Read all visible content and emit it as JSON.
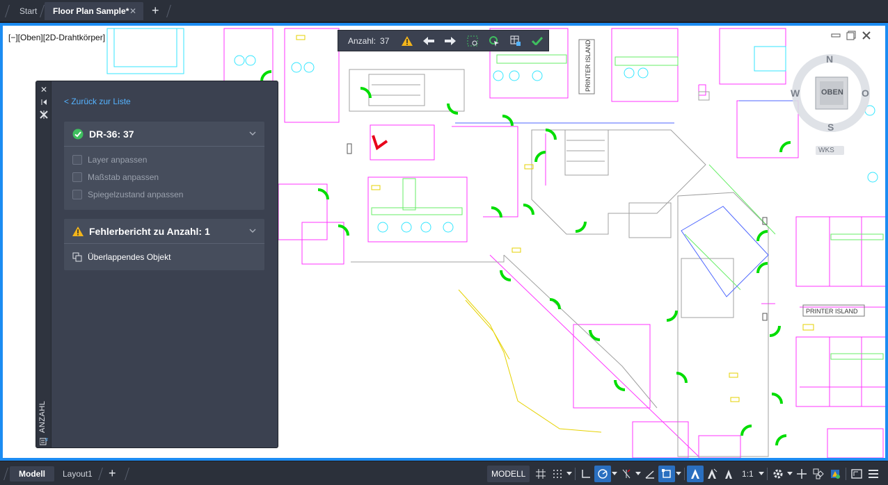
{
  "tabs": {
    "start": "Start",
    "active": "Floor Plan Sample*",
    "close_glyph": "✕",
    "add_glyph": "+"
  },
  "viewport": {
    "view_label": "[−][Oben][2D-Drahtkörper]"
  },
  "count_toolbar": {
    "label": "Anzahl:",
    "value": "37"
  },
  "viewcube": {
    "north": "N",
    "south": "S",
    "west": "W",
    "east": "O",
    "face": "OBEN",
    "ucs": "WKS"
  },
  "plan_labels": {
    "printer_island_vertical": "PRINTER ISLAND",
    "printer_island_horizontal": "PRINTER ISLAND"
  },
  "palette": {
    "strip_title": "ANZAHL",
    "back_link": "< Zurück zur Liste",
    "block_card": {
      "title": "DR-36: 37",
      "options": [
        "Layer anpassen",
        "Maßstab anpassen",
        "Spiegelzustand anpassen"
      ]
    },
    "error_card": {
      "title": "Fehlerbericht zu Anzahl: 1",
      "item": "Überlappendes Objekt"
    }
  },
  "bottom": {
    "model_tab": "Modell",
    "layout_tab": "Layout1",
    "add_glyph": "+",
    "status_model": "MODELL",
    "scale": "1:1"
  },
  "colors": {
    "accent": "#1c8cf2",
    "link": "#55b3ff",
    "success": "#3fbf5f",
    "warning": "#f3b51b",
    "door_green": "#00e000",
    "wall_magenta": "#ff33ff",
    "error_red": "#e8001a"
  }
}
